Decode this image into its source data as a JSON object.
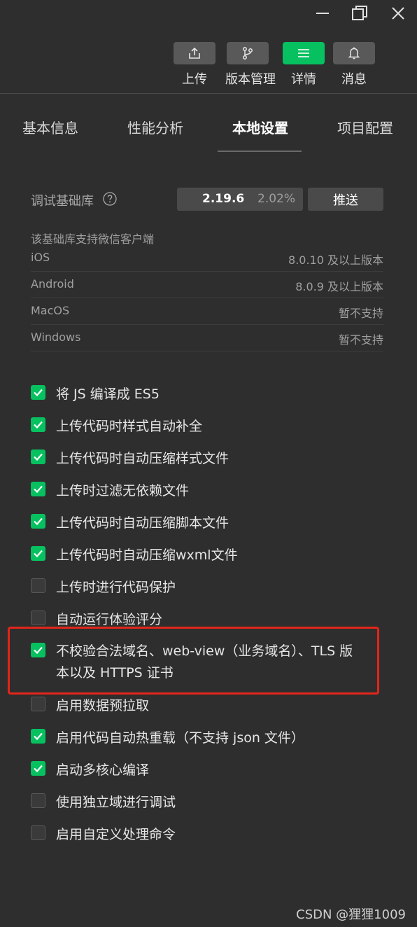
{
  "window_controls": {
    "minimize": "minimize-icon",
    "maximize": "maximize-icon",
    "close": "close-icon"
  },
  "toolbar": [
    {
      "label": "上传",
      "icon": "upload-icon",
      "active": false
    },
    {
      "label": "版本管理",
      "icon": "branch-icon",
      "active": false
    },
    {
      "label": "详情",
      "icon": "menu-icon",
      "active": true
    },
    {
      "label": "消息",
      "icon": "bell-icon",
      "active": false
    }
  ],
  "tabs": [
    {
      "label": "基本信息"
    },
    {
      "label": "性能分析"
    },
    {
      "label": "本地设置",
      "active": true
    },
    {
      "label": "项目配置"
    }
  ],
  "debug_lib": {
    "label": "调试基础库",
    "version": "2.19.6",
    "percent": "2.02%",
    "push_label": "推送"
  },
  "support": {
    "title": "该基础库支持微信客户端",
    "rows": [
      {
        "os": "iOS",
        "version": "8.0.10 及以上版本"
      },
      {
        "os": "Android",
        "version": "8.0.9 及以上版本"
      },
      {
        "os": "MacOS",
        "version": "暂不支持"
      },
      {
        "os": "Windows",
        "version": "暂不支持"
      }
    ]
  },
  "options": [
    {
      "label": "将 JS 编译成 ES5",
      "checked": true
    },
    {
      "label": "上传代码时样式自动补全",
      "checked": true
    },
    {
      "label": "上传代码时自动压缩样式文件",
      "checked": true
    },
    {
      "label": "上传时过滤无依赖文件",
      "checked": true
    },
    {
      "label": "上传代码时自动压缩脚本文件",
      "checked": true
    },
    {
      "label": "上传代码时自动压缩wxml文件",
      "checked": true
    },
    {
      "label": "上传时进行代码保护",
      "checked": false
    },
    {
      "label": "自动运行体验评分",
      "checked": false
    },
    {
      "label": "不校验合法域名、web-view（业务域名）、TLS 版本以及 HTTPS 证书",
      "checked": true
    },
    {
      "label": "启用数据预拉取",
      "checked": false
    },
    {
      "label": "启用代码自动热重载（不支持 json 文件）",
      "checked": true
    },
    {
      "label": "启动多核心编译",
      "checked": true
    },
    {
      "label": "使用独立域进行调试",
      "checked": false
    },
    {
      "label": "启用自定义处理命令",
      "checked": false
    }
  ],
  "colors": {
    "accent": "#07c160",
    "highlight": "#e1251b",
    "background": "#2e2e2e"
  },
  "watermark": "CSDN @狸狸1009"
}
